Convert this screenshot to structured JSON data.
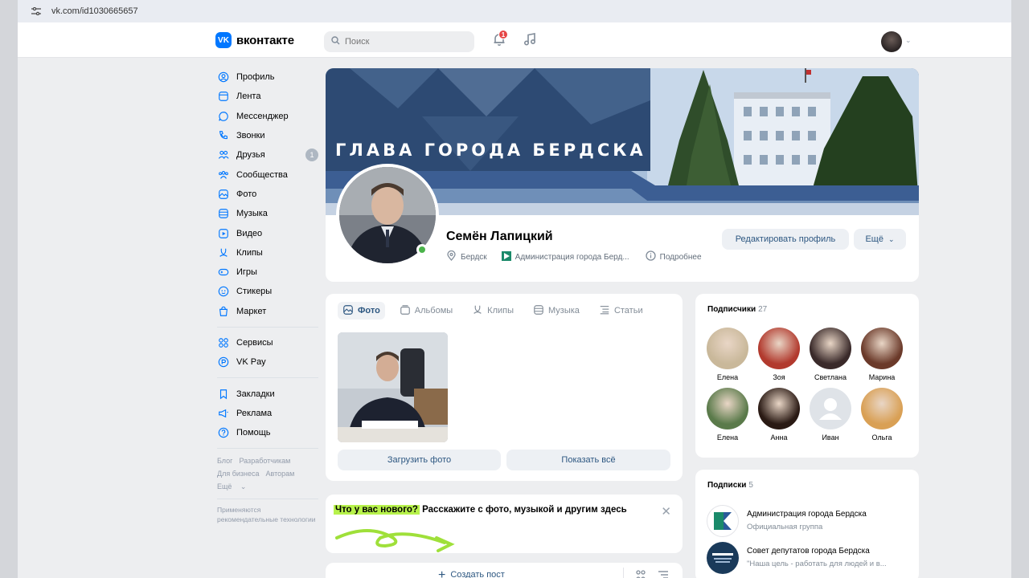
{
  "browser": {
    "url": "vk.com/id1030665657"
  },
  "header": {
    "brand": "вконтакте",
    "search_placeholder": "Поиск",
    "notifications_count": "1"
  },
  "sidebar": {
    "items": [
      {
        "label": "Профиль",
        "icon": "profile-icon"
      },
      {
        "label": "Лента",
        "icon": "feed-icon"
      },
      {
        "label": "Мессенджер",
        "icon": "messenger-icon"
      },
      {
        "label": "Звонки",
        "icon": "phone-icon"
      },
      {
        "label": "Друзья",
        "icon": "friends-icon",
        "count": "1"
      },
      {
        "label": "Сообщества",
        "icon": "communities-icon"
      },
      {
        "label": "Фото",
        "icon": "photo-icon"
      },
      {
        "label": "Музыка",
        "icon": "music-icon"
      },
      {
        "label": "Видео",
        "icon": "video-icon"
      },
      {
        "label": "Клипы",
        "icon": "clips-icon"
      },
      {
        "label": "Игры",
        "icon": "games-icon"
      },
      {
        "label": "Стикеры",
        "icon": "stickers-icon"
      },
      {
        "label": "Маркет",
        "icon": "market-icon"
      }
    ],
    "items2": [
      {
        "label": "Сервисы",
        "icon": "services-icon"
      },
      {
        "label": "VK Pay",
        "icon": "vkpay-icon"
      }
    ],
    "items3": [
      {
        "label": "Закладки",
        "icon": "bookmarks-icon"
      },
      {
        "label": "Реклама",
        "icon": "ads-icon"
      },
      {
        "label": "Помощь",
        "icon": "help-icon"
      }
    ],
    "footer_links": [
      "Блог",
      "Разработчикам",
      "Для бизнеса",
      "Авторам",
      "Ещё"
    ],
    "footer_note": "Применяются рекомендательные технологии"
  },
  "profile": {
    "cover_title": "ГЛАВА ГОРОДА БЕРДСКА",
    "name": "Семён Лапицкий",
    "city": "Бердск",
    "work": "Администрация города Берд...",
    "more_info": "Подробнее",
    "edit_button": "Редактировать профиль",
    "more_button": "Ещё"
  },
  "media": {
    "tabs": [
      {
        "label": "Фото",
        "icon": "photo-icon",
        "active": true
      },
      {
        "label": "Альбомы",
        "icon": "albums-icon",
        "active": false
      },
      {
        "label": "Клипы",
        "icon": "clips-icon",
        "active": false
      },
      {
        "label": "Музыка",
        "icon": "music-icon",
        "active": false
      },
      {
        "label": "Статьи",
        "icon": "articles-icon",
        "active": false
      }
    ],
    "upload_button": "Загрузить фото",
    "show_all_button": "Показать всё"
  },
  "post": {
    "prompt_highlight": "Что у вас нового?",
    "prompt_rest": " Расскажите с фото, музыкой и другим здесь"
  },
  "create_post": {
    "label": "Создать пост"
  },
  "subscribers": {
    "title": "Подписчики",
    "count": "27",
    "people": [
      {
        "name": "Елена",
        "color": "#c9b89a"
      },
      {
        "name": "Зоя",
        "color": "#b23a2e"
      },
      {
        "name": "Светлана",
        "color": "#3a2a2a"
      },
      {
        "name": "Марина",
        "color": "#6b3a2a"
      },
      {
        "name": "Елена",
        "color": "#5a7a4a"
      },
      {
        "name": "Анна",
        "color": "#2a1a14"
      },
      {
        "name": "Иван",
        "color": "#dfe3e8"
      },
      {
        "name": "Ольга",
        "color": "#d9a055"
      }
    ]
  },
  "following": {
    "title": "Подписки",
    "count": "5",
    "groups": [
      {
        "name": "Администрация города Бердска",
        "subtitle": "Официальная группа",
        "color": "#ffffff"
      },
      {
        "name": "Совет депутатов города Бердска",
        "subtitle": "\"Наша цель - работать для людей и в...",
        "color": "#1a3a5a"
      }
    ]
  },
  "colors": {
    "accent": "#0077ff",
    "link": "#2d5781",
    "online": "#4bb34b",
    "badge": "#e64646",
    "highlight": "#b7f24b"
  }
}
